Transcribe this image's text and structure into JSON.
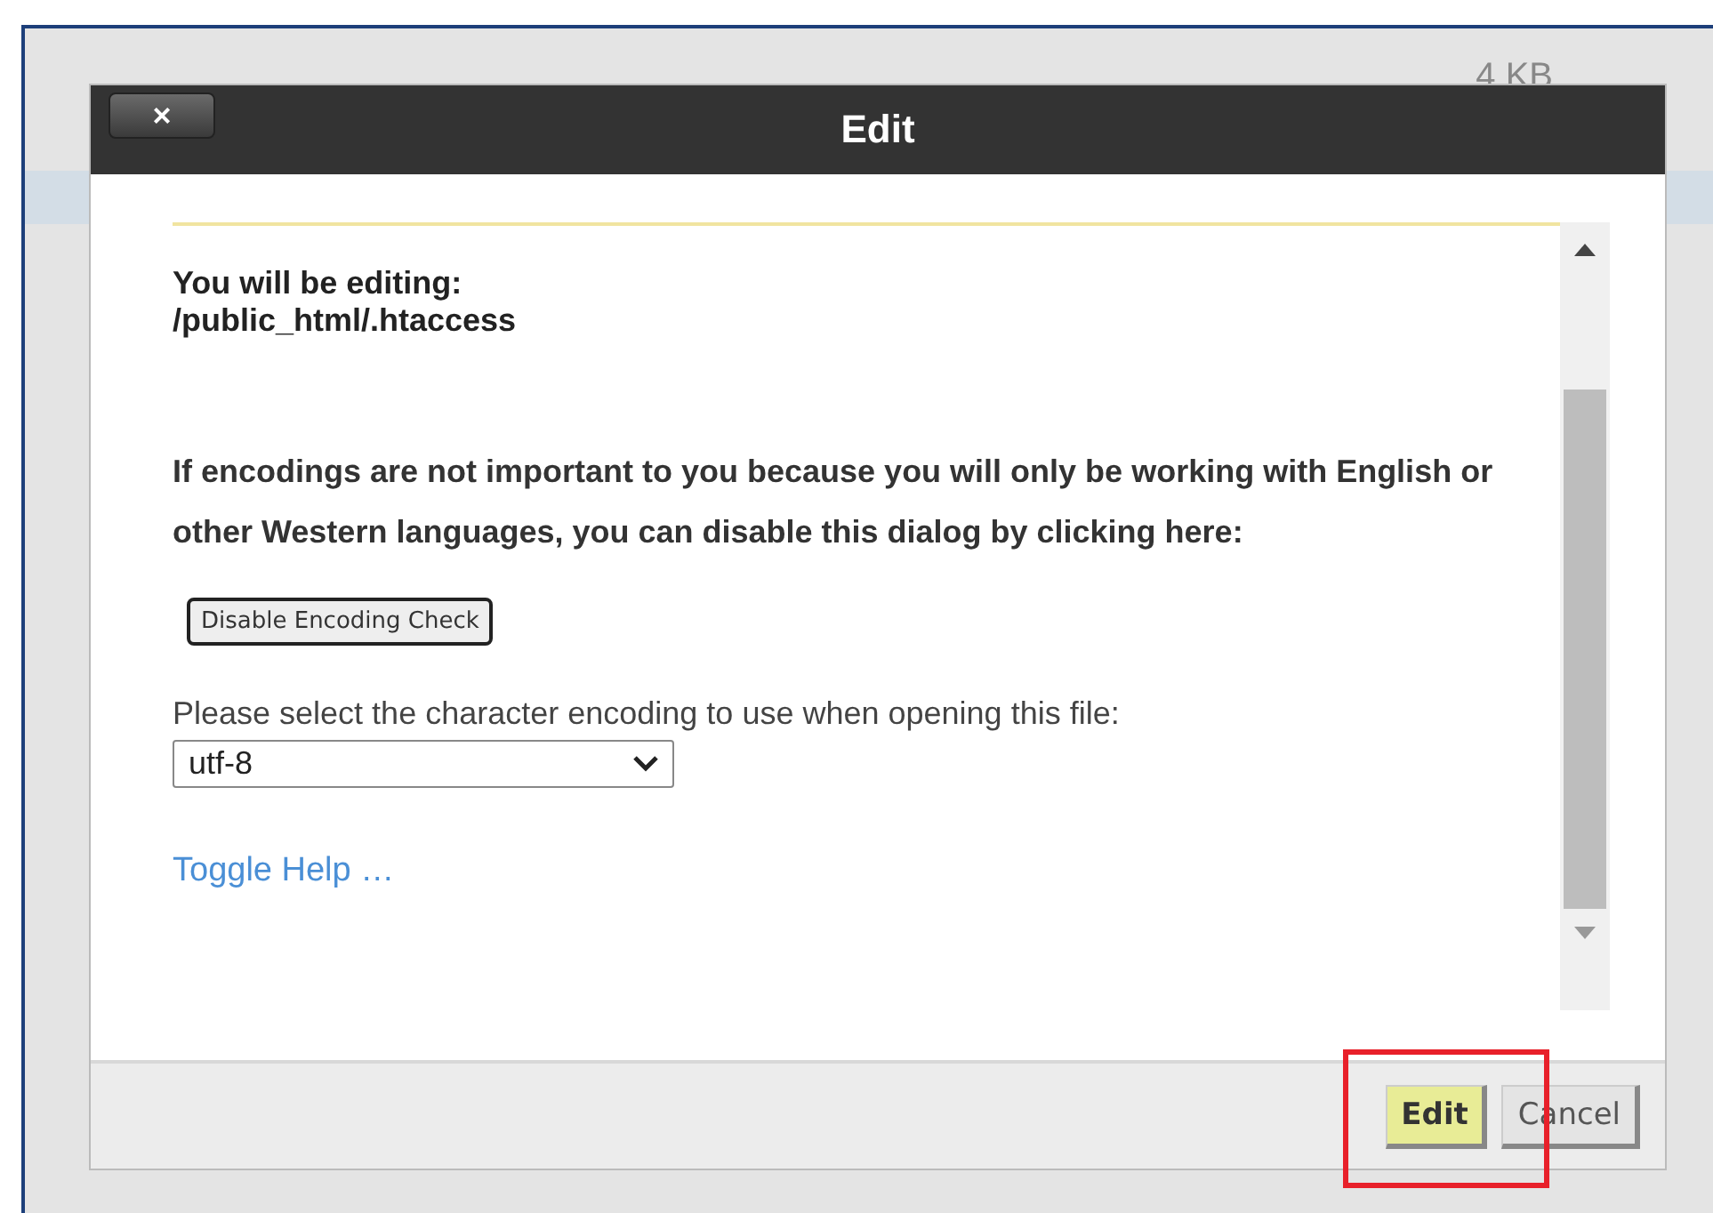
{
  "background": {
    "size_label": "4 KB"
  },
  "dialog": {
    "close_label": "×",
    "title": "Edit",
    "editing_label": "You will be editing:",
    "editing_path": "/public_html/.htaccess",
    "notice": "If encodings are not important to you because you will only be working with English or other Western languages, you can disable this dialog by clicking here:",
    "disable_button": "Disable Encoding Check",
    "encoding_label": "Please select the character encoding to use when opening this file:",
    "encoding_select": {
      "value": "utf-8"
    },
    "help_link": "Toggle Help …",
    "buttons": [
      {
        "label": "Edit",
        "kind": "primary",
        "highlighted": true
      },
      {
        "label": "Cancel",
        "kind": "secondary",
        "highlighted": false
      }
    ]
  }
}
